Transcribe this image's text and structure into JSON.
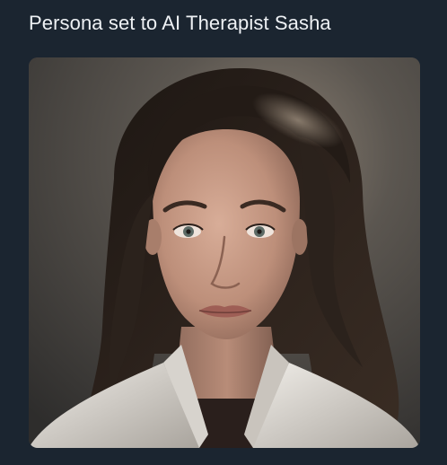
{
  "message": {
    "text": "Persona set to AI Therapist Sasha"
  },
  "image": {
    "alt": "",
    "subject": "portrait-of-woman"
  },
  "colors": {
    "background": "#1b2530",
    "text": "#eef1f4",
    "image_backdrop": "#4a4642",
    "hair": "#2a211c",
    "skin": "#c69b86",
    "blazer": "#e4e1dc"
  }
}
